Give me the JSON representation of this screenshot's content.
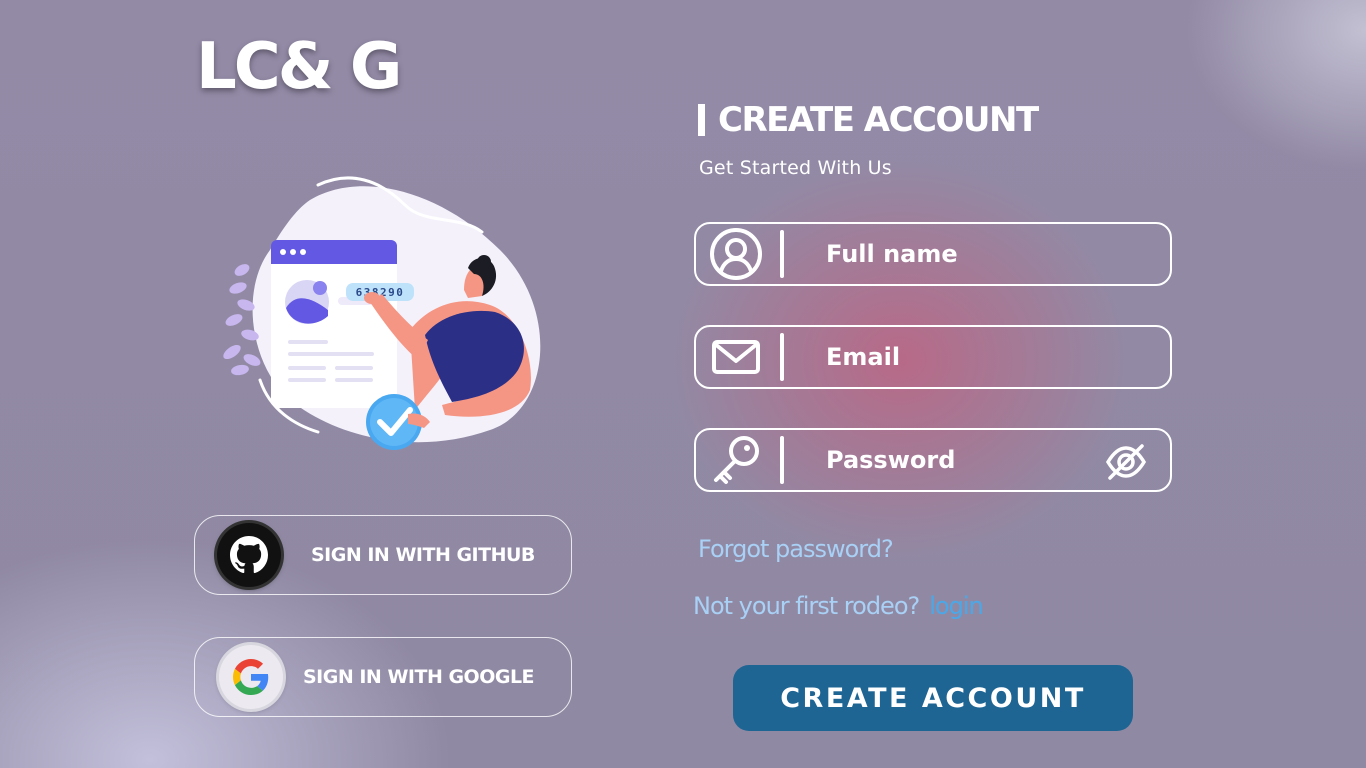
{
  "brand": {
    "logo_text": "LC& G"
  },
  "illustration": {
    "code_text": "638290"
  },
  "social": {
    "github_label": "SIGN IN WITH GITHUB",
    "google_label": "SIGN IN WITH GOOGLE",
    "github_icon": "github-icon",
    "google_icon": "google-icon"
  },
  "form": {
    "title": "CREATE ACCOUNT",
    "subtitle": "Get Started With Us",
    "fullname_placeholder": "Full name",
    "email_placeholder": "Email",
    "password_placeholder": "Password",
    "forgot_link": "Forgot password?",
    "rodeo_text": "Not your first rodeo?",
    "login_link": "login",
    "submit_label": "CREATE ACCOUNT"
  },
  "colors": {
    "background": "#928aa4",
    "accent_glow": "#be6482",
    "submit_button": "#1e6594",
    "link": "#a9d0f5",
    "login_link": "#4aa8e8"
  }
}
